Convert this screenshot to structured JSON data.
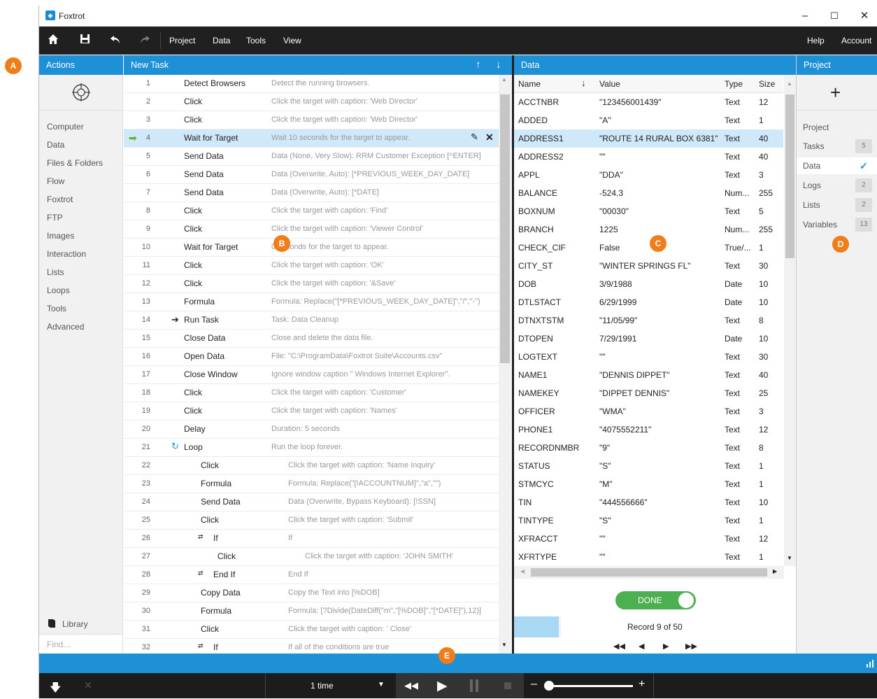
{
  "app": {
    "title": "Foxtrot"
  },
  "window_controls": {
    "minimize": "–",
    "maximize": "☐",
    "close": "✕"
  },
  "menu": {
    "items": [
      "Project",
      "Data",
      "Tools",
      "View"
    ],
    "help": "Help",
    "account": "Account"
  },
  "actions": {
    "header": "Actions",
    "items": [
      "Computer",
      "Data",
      "Files & Folders",
      "Flow",
      "Foxtrot",
      "FTP",
      "Images",
      "Interaction",
      "Lists",
      "Loops",
      "Tools",
      "Advanced"
    ],
    "library": "Library",
    "find_placeholder": "Find..."
  },
  "tasks": {
    "header": "New Task",
    "rows": [
      {
        "n": "1",
        "name": "Detect Browsers",
        "desc": "Detect the running browsers."
      },
      {
        "n": "2",
        "name": "Click",
        "desc": "Click the target with caption: 'Web Director'"
      },
      {
        "n": "3",
        "name": "Click",
        "desc": "Click the target with caption: 'Web Director'"
      },
      {
        "n": "4",
        "name": "Wait for Target",
        "desc": "Wait 10 seconds for the target to appear."
      },
      {
        "n": "5",
        "name": "Send Data",
        "desc": "Data (None, Very Slow): RRM Customer Exception [^ENTER]"
      },
      {
        "n": "6",
        "name": "Send Data",
        "desc": "Data (Overwrite, Auto): [*PREVIOUS_WEEK_DAY_DATE]"
      },
      {
        "n": "7",
        "name": "Send Data",
        "desc": "Data (Overwrite, Auto): [*DATE]"
      },
      {
        "n": "8",
        "name": "Click",
        "desc": "Click the target with caption: 'Find'"
      },
      {
        "n": "9",
        "name": "Click",
        "desc": "Click the target with caption: 'Viewer Control'"
      },
      {
        "n": "10",
        "name": "Wait for Target",
        "desc": "0 seconds for the target to appear."
      },
      {
        "n": "11",
        "name": "Click",
        "desc": "Click the target with caption: 'OK'"
      },
      {
        "n": "12",
        "name": "Click",
        "desc": "Click the target with caption: '&Save'"
      },
      {
        "n": "13",
        "name": "Formula",
        "desc": "Formula: Replace(\"[*PREVIOUS_WEEK_DAY_DATE]\",\"/\",\"-\")"
      },
      {
        "n": "14",
        "name": "Run Task",
        "desc": "Task: Data Cleanup"
      },
      {
        "n": "15",
        "name": "Close Data",
        "desc": "Close and delete the data file."
      },
      {
        "n": "16",
        "name": "Open Data",
        "desc": "File: \"C:\\ProgramData\\Foxtrot Suite\\Accounts.csv\""
      },
      {
        "n": "17",
        "name": "Close Window",
        "desc": "Ignore window caption \" Windows Internet Explorer\"."
      },
      {
        "n": "18",
        "name": "Click",
        "desc": "Click the target with caption: 'Customer'"
      },
      {
        "n": "19",
        "name": "Click",
        "desc": "Click the target with caption: 'Names'"
      },
      {
        "n": "20",
        "name": "Delay",
        "desc": "Duration: 5 seconds"
      },
      {
        "n": "21",
        "name": "Loop",
        "desc": "Run the loop forever."
      },
      {
        "n": "22",
        "name": "Click",
        "desc": "Click the target with caption: 'Name Inquiry'"
      },
      {
        "n": "23",
        "name": "Formula",
        "desc": "Formula: Replace(\"[!ACCOUNTNUM]\",\"a\",\"\")"
      },
      {
        "n": "24",
        "name": "Send Data",
        "desc": "Data (Overwrite, Bypass Keyboard): [!SSN]"
      },
      {
        "n": "25",
        "name": "Click",
        "desc": "Click the target with caption: 'Submit'"
      },
      {
        "n": "26",
        "name": "If",
        "desc": "If"
      },
      {
        "n": "27",
        "name": "Click",
        "desc": "Click the target with caption: 'JOHN SMITH'"
      },
      {
        "n": "28",
        "name": "End If",
        "desc": "End If"
      },
      {
        "n": "29",
        "name": "Copy Data",
        "desc": "Copy the Text into [%DOB]"
      },
      {
        "n": "30",
        "name": "Formula",
        "desc": "Formula: [?Divide(DateDiff(\"m\",\"[%DOB]\",\"[*DATE]\"),12)]"
      },
      {
        "n": "31",
        "name": "Click",
        "desc": "Click the target with caption: ' Close'"
      },
      {
        "n": "32",
        "name": "If",
        "desc": "If  all of the conditions are true"
      }
    ]
  },
  "data_panel": {
    "header": "Data",
    "columns": [
      "Name",
      "Value",
      "Type",
      "Size"
    ],
    "rows": [
      [
        "ACCTNBR",
        "\"123456001439\"",
        "Text",
        "12"
      ],
      [
        "ADDED",
        "\"A\"",
        "Text",
        "1"
      ],
      [
        "ADDRESS1",
        "\"ROUTE 14 RURAL BOX 6381\"",
        "Text",
        "40"
      ],
      [
        "ADDRESS2",
        "\"\"",
        "Text",
        "40"
      ],
      [
        "APPL",
        "\"DDA\"",
        "Text",
        "3"
      ],
      [
        "BALANCE",
        "-524.3",
        "Num...",
        "255"
      ],
      [
        "BOXNUM",
        "\"00030\"",
        "Text",
        "5"
      ],
      [
        "BRANCH",
        "1225",
        "Num...",
        "255"
      ],
      [
        "CHECK_CIF",
        "False",
        "True/...",
        "1"
      ],
      [
        "CITY_ST",
        "\"WINTER SPRINGS FL\"",
        "Text",
        "30"
      ],
      [
        "DOB",
        "3/9/1988",
        "Date",
        "10"
      ],
      [
        "DTLSTACT",
        "6/29/1999",
        "Date",
        "10"
      ],
      [
        "DTNXTSTM",
        "\"11/05/99\"",
        "Text",
        "8"
      ],
      [
        "DTOPEN",
        "7/29/1991",
        "Date",
        "10"
      ],
      [
        "LOGTEXT",
        "\"\"",
        "Text",
        "30"
      ],
      [
        "NAME1",
        "\"DENNIS DIPPET\"",
        "Text",
        "40"
      ],
      [
        "NAMEKEY",
        "\"DIPPET DENNIS\"",
        "Text",
        "25"
      ],
      [
        "OFFICER",
        "\"WMA\"",
        "Text",
        "3"
      ],
      [
        "PHONE1",
        "\"4075552211\"",
        "Text",
        "12"
      ],
      [
        "RECORDNMBR",
        "\"9\"",
        "Text",
        "8"
      ],
      [
        "STATUS",
        "\"S\"",
        "Text",
        "1"
      ],
      [
        "STMCYC",
        "\"M\"",
        "Text",
        "1"
      ],
      [
        "TIN",
        "\"444556666\"",
        "Text",
        "10"
      ],
      [
        "TINTYPE",
        "\"S\"",
        "Text",
        "1"
      ],
      [
        "XFRACCT",
        "\"\"",
        "Text",
        "12"
      ],
      [
        "XFRTYPE",
        "\"\"",
        "Text",
        "1"
      ]
    ],
    "done_label": "DONE",
    "record_label": "Record 9 of 50"
  },
  "project_panel": {
    "header": "Project",
    "title": "Project",
    "items": [
      {
        "label": "Tasks",
        "badge": "5"
      },
      {
        "label": "Data",
        "badge": "✓"
      },
      {
        "label": "Logs",
        "badge": "2"
      },
      {
        "label": "Lists",
        "badge": "2"
      },
      {
        "label": "Variables",
        "badge": "13"
      }
    ]
  },
  "playback": {
    "repeat": "1 time"
  },
  "callouts": [
    "A",
    "B",
    "C",
    "D",
    "E"
  ],
  "colors": {
    "accent": "#1e90d6",
    "callout": "#f07c1a",
    "toggle": "#4caf50",
    "selected_row": "#cfe8fa"
  }
}
